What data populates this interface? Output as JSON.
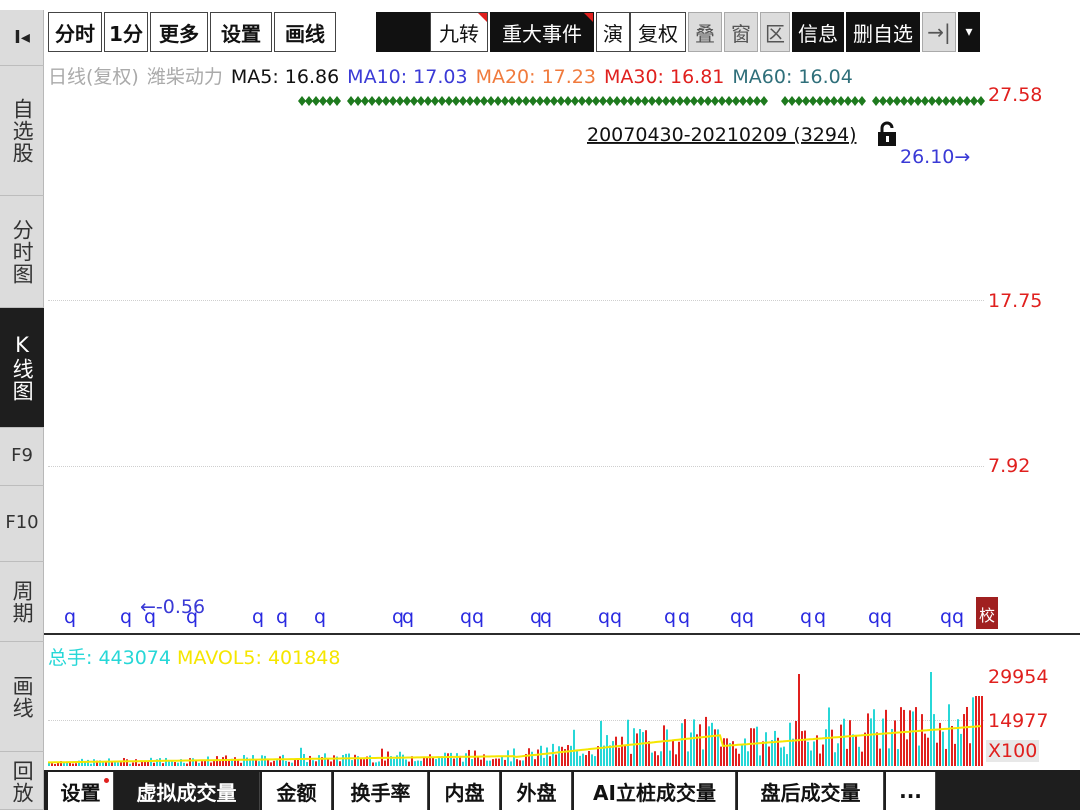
{
  "sidebar": {
    "collapse_glyph": "I◂",
    "items": [
      {
        "label": "自选股"
      },
      {
        "label": "分时图"
      },
      {
        "label": "K线图"
      },
      {
        "label": "F9"
      },
      {
        "label": "F10"
      },
      {
        "label": "周期"
      },
      {
        "label": "画线"
      },
      {
        "label": "回放"
      }
    ]
  },
  "toolbar": {
    "buttons": [
      {
        "label": "分时"
      },
      {
        "label": "1分"
      },
      {
        "label": "更多"
      },
      {
        "label": "设置"
      },
      {
        "label": "画线"
      },
      {
        "label": ""
      },
      {
        "label": "九转"
      },
      {
        "label": "重大事件"
      },
      {
        "label": "演"
      },
      {
        "label": "复权"
      },
      {
        "label": "叠"
      },
      {
        "label": "窗"
      },
      {
        "label": "区"
      },
      {
        "label": "信息"
      },
      {
        "label": "删自选"
      },
      {
        "label": "→|"
      },
      {
        "label": "▾"
      }
    ]
  },
  "legend": {
    "period": "日线(复权)",
    "stock": "潍柴动力",
    "ma5": "MA5: 16.86",
    "ma10": "MA10: 17.03",
    "ma20": "MA20: 17.23",
    "ma30": "MA30: 16.81",
    "ma60": "MA60: 16.04"
  },
  "price_axis": {
    "top": "27.58",
    "mid": "17.75",
    "low": "7.92",
    "marker": "26.10→"
  },
  "range_label": "20070430-20210209 (3294)",
  "min_marker": "←-0.56",
  "event_marker_glyph": "q",
  "last_marker": "校",
  "volume": {
    "total": "总手: 443074",
    "mavol5": "MAVOL5: 401848",
    "axis_top": "29954",
    "axis_mid": "14977",
    "unit": "X100"
  },
  "bottom_tabs": [
    {
      "label": "设置"
    },
    {
      "label": "虚拟成交量"
    },
    {
      "label": "金额"
    },
    {
      "label": "换手率"
    },
    {
      "label": "内盘"
    },
    {
      "label": "外盘"
    },
    {
      "label": "AI立桩成交量"
    },
    {
      "label": "盘后成交量"
    },
    {
      "label": "..."
    }
  ],
  "colors": {
    "ma5": "#111111",
    "ma10": "#3a3ad6",
    "ma20": "#f07a3c",
    "ma30": "#e0201e",
    "ma60": "#2f6f7a",
    "axis_red": "#e0201e",
    "volume_up": "#e0201e",
    "volume_down": "#27d7d7",
    "volume_ma": "#f5e600",
    "diamonds": "#1e7a1e",
    "event_q": "#2a2ae0"
  }
}
